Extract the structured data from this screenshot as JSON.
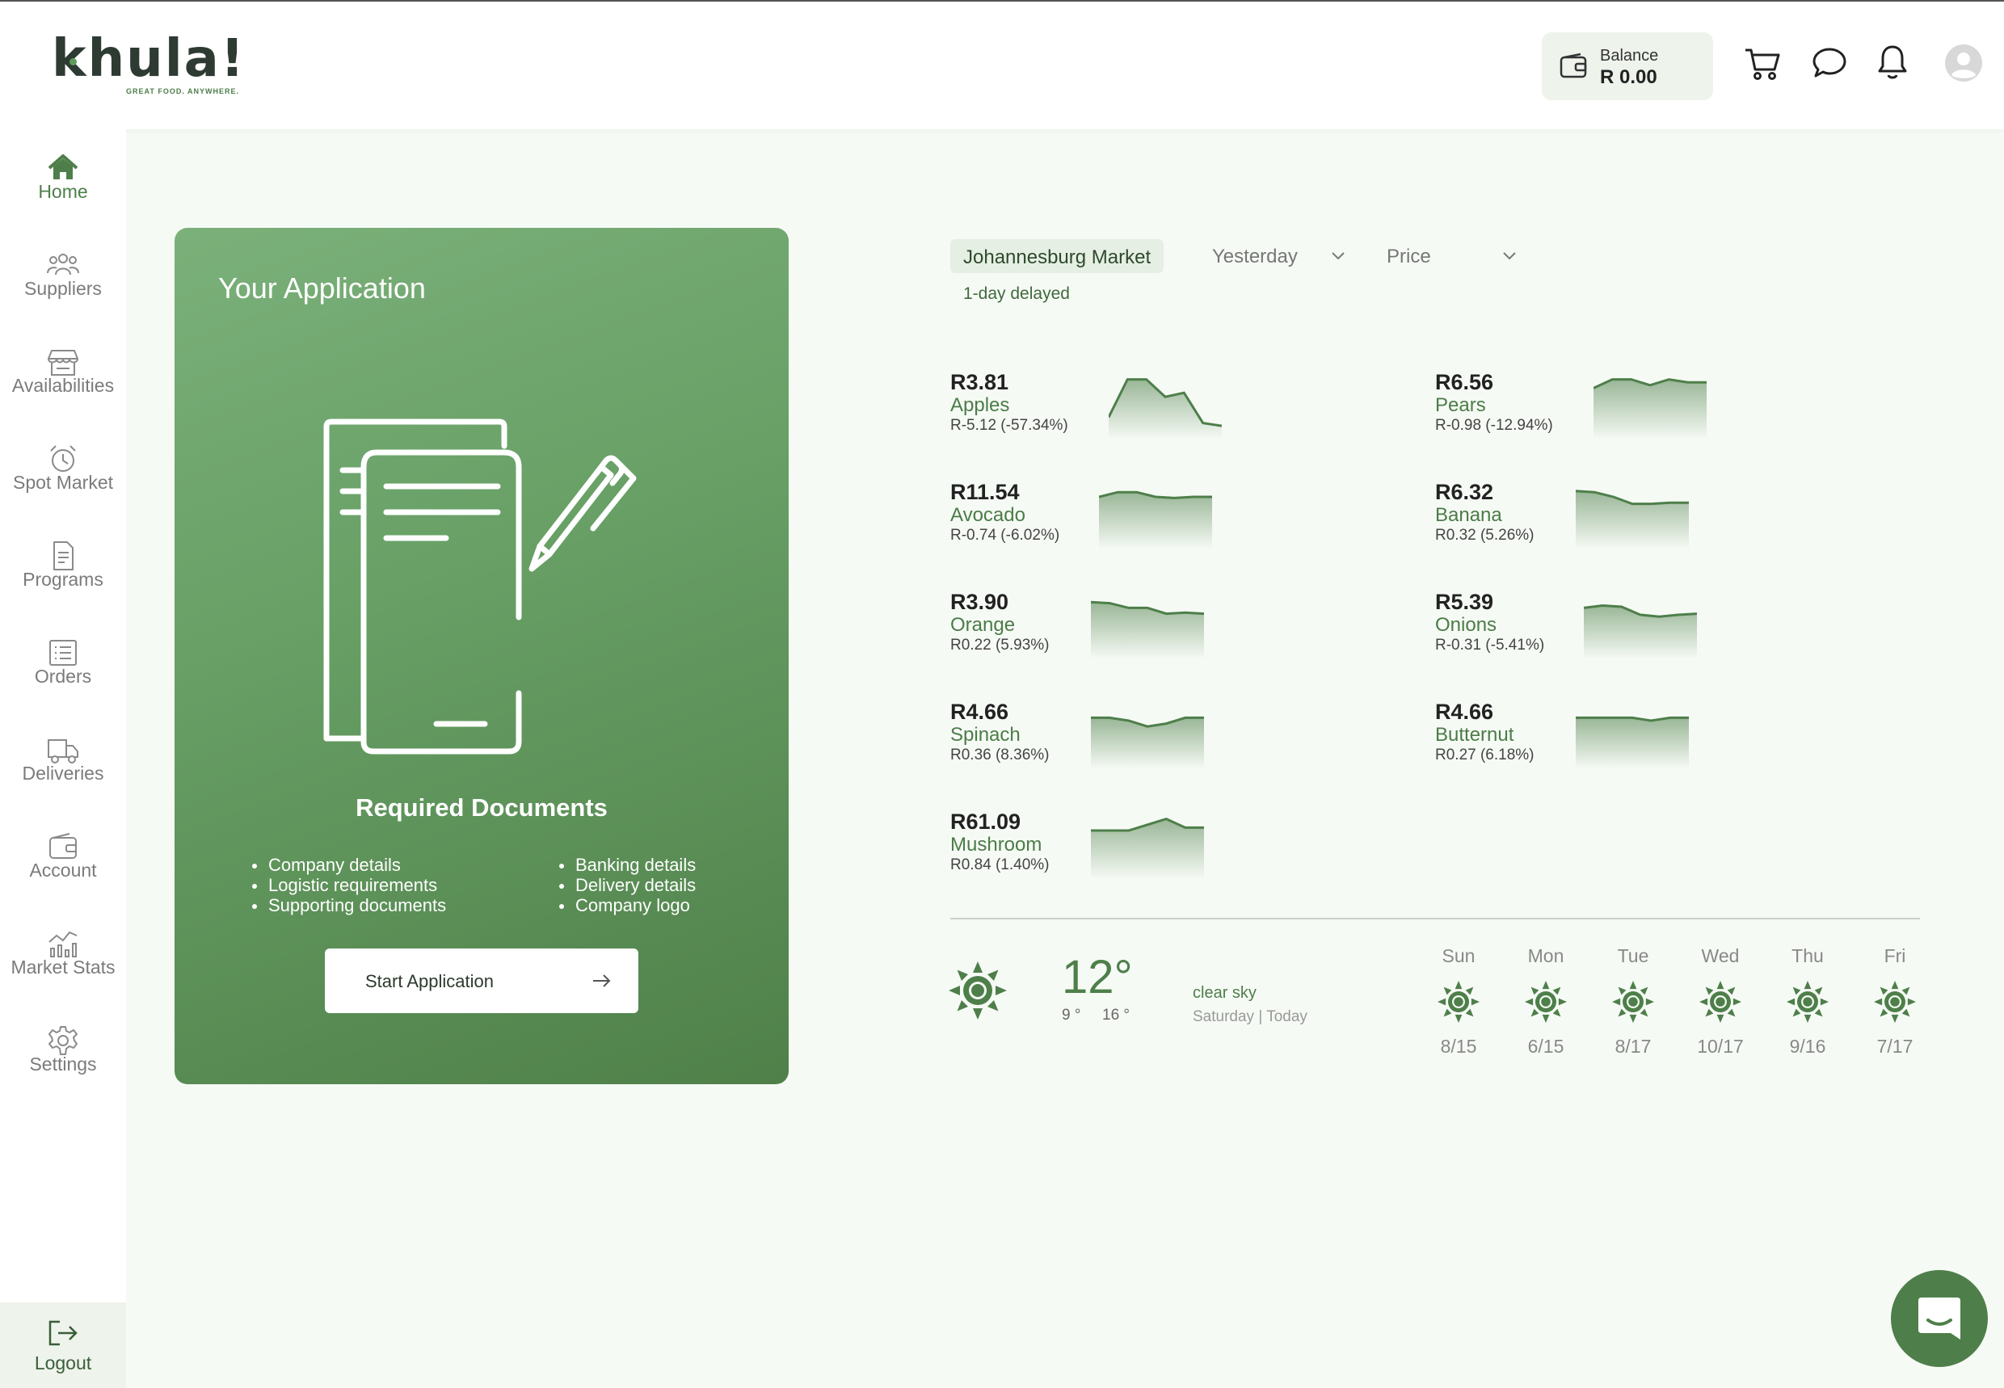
{
  "brand": {
    "name": "khula!",
    "tagline": "GREAT FOOD. ANYWHERE."
  },
  "header": {
    "balance_label": "Balance",
    "balance_value": "R 0.00"
  },
  "sidebar": {
    "items": [
      {
        "label": "Home",
        "icon": "home-icon",
        "active": true
      },
      {
        "label": "Suppliers",
        "icon": "users-icon"
      },
      {
        "label": "Availabilities",
        "icon": "store-icon"
      },
      {
        "label": "Spot Market",
        "icon": "alarm-clock-icon"
      },
      {
        "label": "Programs",
        "icon": "document-icon"
      },
      {
        "label": "Orders",
        "icon": "list-icon"
      },
      {
        "label": "Deliveries",
        "icon": "truck-icon"
      },
      {
        "label": "Account",
        "icon": "wallet-icon"
      },
      {
        "label": "Market Stats",
        "icon": "stats-icon"
      },
      {
        "label": "Settings",
        "icon": "gear-icon"
      }
    ],
    "logout_label": "Logout"
  },
  "application": {
    "title": "Your Application",
    "required_title": "Required Documents",
    "left_list": [
      "Company details",
      "Logistic requirements",
      "Supporting documents"
    ],
    "right_list": [
      "Banking details",
      "Delivery details",
      "Company logo"
    ],
    "button_label": "Start Application"
  },
  "market": {
    "market_name": "Johannesburg Market",
    "delay_note": "1-day delayed",
    "period": "Yesterday",
    "metric": "Price",
    "items": [
      {
        "price": "R3.81",
        "name": "Apples",
        "change": "R-5.12 (-57.34%)",
        "spark": [
          0.3,
          0.95,
          0.95,
          0.65,
          0.72,
          0.2,
          0.15
        ]
      },
      {
        "price": "R6.56",
        "name": "Pears",
        "change": "R-0.98 (-12.94%)",
        "spark": [
          0.8,
          0.95,
          0.95,
          0.85,
          0.95,
          0.9,
          0.9
        ]
      },
      {
        "price": "R11.54",
        "name": "Avocado",
        "change": "R-0.74 (-6.02%)",
        "spark": [
          0.82,
          0.9,
          0.9,
          0.82,
          0.8,
          0.82,
          0.82
        ]
      },
      {
        "price": "R6.32",
        "name": "Banana",
        "change": "R0.32 (5.26%)",
        "spark": [
          0.92,
          0.9,
          0.82,
          0.7,
          0.7,
          0.72,
          0.72
        ]
      },
      {
        "price": "R3.90",
        "name": "Orange",
        "change": "R0.22 (5.93%)",
        "spark": [
          0.9,
          0.88,
          0.8,
          0.8,
          0.7,
          0.72,
          0.7
        ]
      },
      {
        "price": "R5.39",
        "name": "Onions",
        "change": "R-0.31 (-5.41%)",
        "spark": [
          0.8,
          0.84,
          0.82,
          0.68,
          0.65,
          0.68,
          0.7
        ]
      },
      {
        "price": "R4.66",
        "name": "Spinach",
        "change": "R0.36 (8.36%)",
        "spark": [
          0.8,
          0.8,
          0.75,
          0.65,
          0.7,
          0.8,
          0.8
        ]
      },
      {
        "price": "R4.66",
        "name": "Butternut",
        "change": "R0.27 (6.18%)",
        "spark": [
          0.8,
          0.8,
          0.8,
          0.8,
          0.75,
          0.8,
          0.8
        ]
      },
      {
        "price": "R61.09",
        "name": "Mushroom",
        "change": "R0.84 (1.40%)",
        "spark": [
          0.75,
          0.75,
          0.75,
          0.85,
          0.95,
          0.8,
          0.8
        ]
      }
    ]
  },
  "weather": {
    "temp": "12°",
    "low": "9 °",
    "high": "16 °",
    "description": "clear sky",
    "date_text": "Saturday | Today",
    "forecast": [
      {
        "day": "Sun",
        "date": "8/15"
      },
      {
        "day": "Mon",
        "date": "6/15"
      },
      {
        "day": "Tue",
        "date": "8/17"
      },
      {
        "day": "Wed",
        "date": "10/17"
      },
      {
        "day": "Thu",
        "date": "9/16"
      },
      {
        "day": "Fri",
        "date": "7/17"
      }
    ]
  },
  "colors": {
    "accent": "#4e7f4a",
    "card_start": "#7bb07a",
    "card_end": "#4f8049",
    "background": "#f6faf5"
  }
}
